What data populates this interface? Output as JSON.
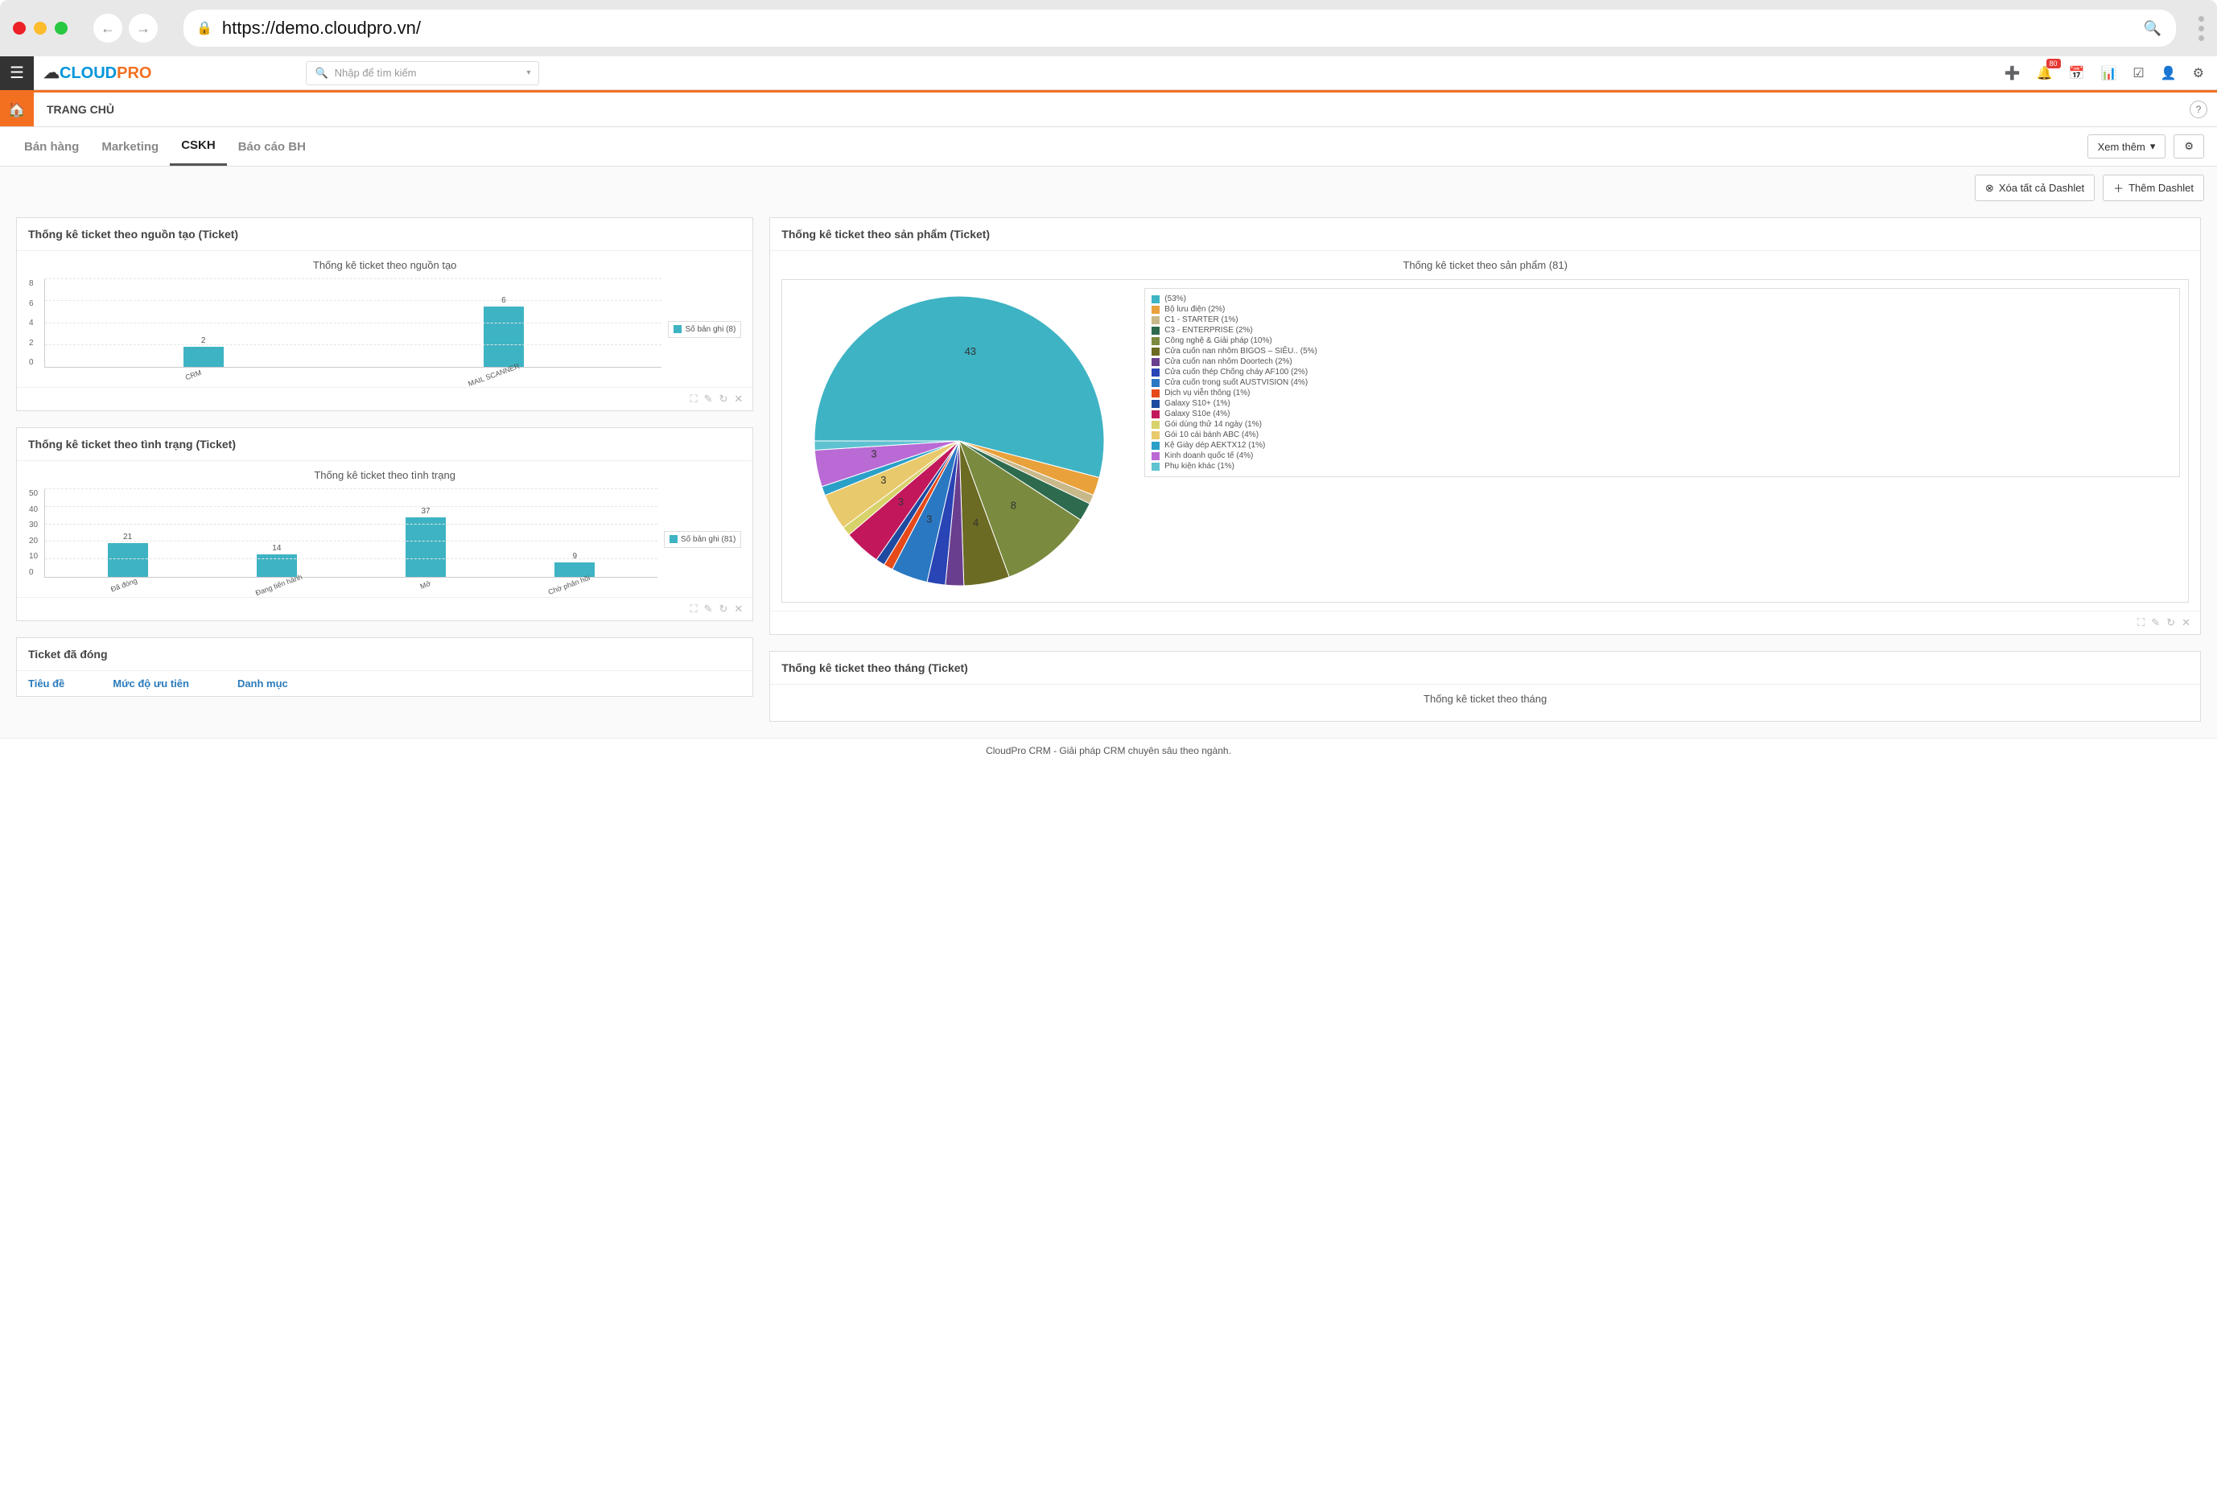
{
  "browser": {
    "url": "https://demo.cloudpro.vn/"
  },
  "header": {
    "logo_part1": "CLOUD",
    "logo_part2": "PRO",
    "search_placeholder": "Nhập để tìm kiếm",
    "notification_badge": "80"
  },
  "page": {
    "title": "TRANG CHỦ"
  },
  "tabs": [
    {
      "label": "Bán hàng",
      "active": false
    },
    {
      "label": "Marketing",
      "active": false
    },
    {
      "label": "CSKH",
      "active": true
    },
    {
      "label": "Báo cáo BH",
      "active": false
    }
  ],
  "tab_actions": {
    "view_more": "Xem thêm"
  },
  "dashlet_actions": {
    "remove_all": "Xóa tất cả Dashlet",
    "add": "Thêm Dashlet"
  },
  "dashlets": {
    "source": {
      "header": "Thống kê ticket theo nguồn tạo (Ticket)",
      "chart_title": "Thống kê ticket theo nguồn tạo",
      "legend": "Số bản ghi (8)"
    },
    "status": {
      "header": "Thống kê ticket theo tình trạng (Ticket)",
      "chart_title": "Thống kê ticket theo tình trạng",
      "legend": "Số bản ghi (81)"
    },
    "product": {
      "header": "Thống kê ticket theo sản phẩm (Ticket)",
      "chart_title": "Thống kê ticket theo sản phẩm (81)"
    },
    "closed": {
      "header": "Ticket đã đóng",
      "columns": {
        "title": "Tiêu đề",
        "priority": "Mức độ ưu tiên",
        "category": "Danh mục"
      }
    },
    "month": {
      "header": "Thống kê ticket theo tháng (Ticket)",
      "chart_title": "Thống kê ticket theo tháng"
    }
  },
  "footer": "CloudPro CRM - Giải pháp CRM chuyên sâu theo ngành.",
  "chart_data": [
    {
      "id": "source",
      "type": "bar",
      "title": "Thống kê ticket theo nguồn tạo",
      "categories": [
        "CRM",
        "MAIL SCANNER"
      ],
      "values": [
        2,
        6
      ],
      "ylabel": "",
      "xlabel": "",
      "ylim": [
        0,
        8
      ],
      "y_ticks": [
        0,
        2,
        4,
        6,
        8
      ],
      "legend": "Số bản ghi (8)"
    },
    {
      "id": "status",
      "type": "bar",
      "title": "Thống kê ticket theo tình trạng",
      "categories": [
        "Đã đóng",
        "Đang tiến hành",
        "Mở",
        "Chờ phản hồi"
      ],
      "values": [
        21,
        14,
        37,
        9
      ],
      "ylabel": "",
      "xlabel": "",
      "ylim": [
        0,
        50
      ],
      "y_ticks": [
        0,
        10,
        20,
        30,
        40,
        50
      ],
      "legend": "Số bản ghi (81)"
    },
    {
      "id": "product",
      "type": "pie",
      "title": "Thống kê ticket theo sản phẩm (81)",
      "total": 81,
      "series": [
        {
          "name": "(53%)",
          "value": 43,
          "pct": 53,
          "color": "#3eb3c4"
        },
        {
          "name": "Bộ lưu điện (2%)",
          "value": 2,
          "pct": 2,
          "color": "#e9a13b"
        },
        {
          "name": "C1 - STARTER (1%)",
          "value": 1,
          "pct": 1,
          "color": "#c9b98a"
        },
        {
          "name": "C3 - ENTERPRISE (2%)",
          "value": 2,
          "pct": 2,
          "color": "#2e6b4e"
        },
        {
          "name": "Công nghệ & Giải pháp (10%)",
          "value": 8,
          "pct": 10,
          "color": "#7a8a3f"
        },
        {
          "name": "Cửa cuốn nan nhôm BIGOS – SIÊU.. (5%)",
          "value": 4,
          "pct": 5,
          "color": "#6b6b23"
        },
        {
          "name": "Cửa cuốn nan nhôm Doortech (2%)",
          "value": 2,
          "pct": 2,
          "color": "#6a3e8e"
        },
        {
          "name": "Cửa cuốn thép Chống cháy AF100 (2%)",
          "value": 2,
          "pct": 2,
          "color": "#2944b5"
        },
        {
          "name": "Cửa cuốn trong suốt AUSTVISION (4%)",
          "value": 3,
          "pct": 4,
          "color": "#2a78c2"
        },
        {
          "name": "Dịch vụ viễn thông (1%)",
          "value": 1,
          "pct": 1,
          "color": "#e64a19"
        },
        {
          "name": "Galaxy S10+ (1%)",
          "value": 1,
          "pct": 1,
          "color": "#1e4aa0"
        },
        {
          "name": "Galaxy S10e (4%)",
          "value": 3,
          "pct": 4,
          "color": "#c2185b"
        },
        {
          "name": "Gói dùng thử 14 ngày (1%)",
          "value": 1,
          "pct": 1,
          "color": "#d8d26a"
        },
        {
          "name": "Gói 10 cái bánh ABC (4%)",
          "value": 3,
          "pct": 4,
          "color": "#e8c96b"
        },
        {
          "name": "Kệ Giày dép AEKTX12 (1%)",
          "value": 1,
          "pct": 1,
          "color": "#2aa0c8"
        },
        {
          "name": "Kinh doanh quốc tế (4%)",
          "value": 3,
          "pct": 4,
          "color": "#b96ad4"
        },
        {
          "name": "Phụ kiện khác (1%)",
          "value": 1,
          "pct": 1,
          "color": "#5fc2d0"
        }
      ],
      "slice_labels": [
        {
          "text": "43"
        },
        {
          "text": "8"
        },
        {
          "text": "4"
        },
        {
          "text": "3"
        },
        {
          "text": "3"
        },
        {
          "text": "3"
        },
        {
          "text": "3"
        }
      ]
    }
  ]
}
